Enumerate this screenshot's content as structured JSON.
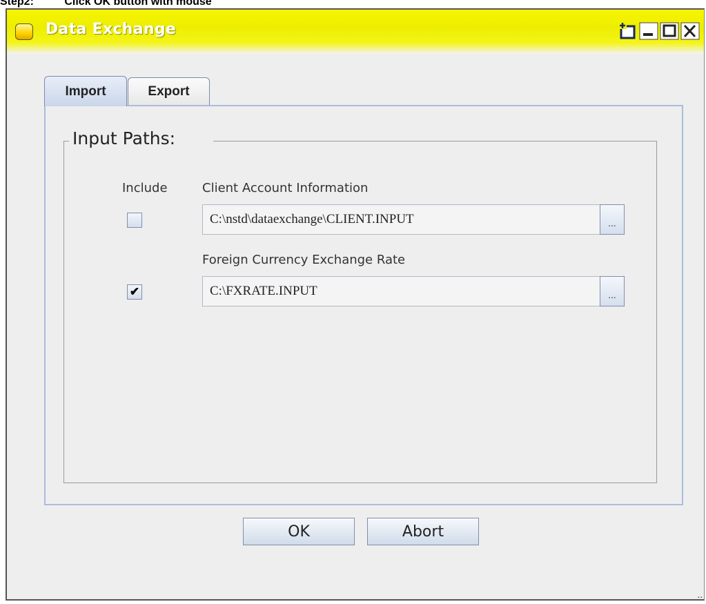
{
  "caption": {
    "step": "Step2:",
    "instruction": "Click OK button with mouse"
  },
  "window": {
    "title": "Data Exchange",
    "controls": {
      "pin_icon": "pin-icon",
      "minimize_icon": "minimize-icon",
      "maximize_icon": "maximize-icon",
      "close_icon": "close-icon"
    },
    "title_color": "#f0f000"
  },
  "tabs": [
    {
      "label": "Import",
      "active": true
    },
    {
      "label": "Export",
      "active": false
    }
  ],
  "import_panel": {
    "group_title": "Input Paths:",
    "include_header": "Include",
    "rows": [
      {
        "label": "Client Account Information",
        "included": false,
        "path": "C:\\nstd\\dataexchange\\CLIENT.INPUT",
        "browse_label": "..."
      },
      {
        "label": "Foreign Currency Exchange Rate",
        "included": true,
        "path": "C:\\FXRATE.INPUT",
        "browse_label": "..."
      }
    ]
  },
  "buttons": {
    "ok_label": "OK",
    "abort_label": "Abort"
  },
  "checkmark_glyph": "✔"
}
